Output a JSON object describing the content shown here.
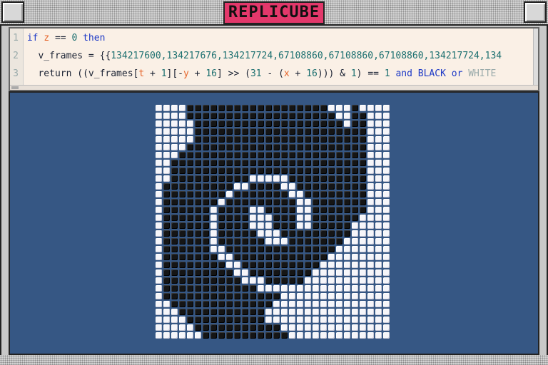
{
  "window": {
    "title": "REPLICUBE"
  },
  "editor": {
    "lines": [
      {
        "number": "1",
        "tokens": [
          {
            "t": "if ",
            "c": "kw"
          },
          {
            "t": "z",
            "c": "var"
          },
          {
            "t": " == ",
            "c": "code"
          },
          {
            "t": "0",
            "c": "num"
          },
          {
            "t": " then",
            "c": "kw"
          }
        ]
      },
      {
        "number": "2",
        "tokens": [
          {
            "t": "  v_frames = {{",
            "c": "code"
          },
          {
            "t": "134217600,134217676,134217724,67108860,67108860,67108860,134217724,134",
            "c": "num"
          }
        ]
      },
      {
        "number": "3",
        "tokens": [
          {
            "t": "  return ((v_frames[",
            "c": "code"
          },
          {
            "t": "t",
            "c": "var"
          },
          {
            "t": " + ",
            "c": "code"
          },
          {
            "t": "1",
            "c": "num"
          },
          {
            "t": "][-",
            "c": "code"
          },
          {
            "t": "y",
            "c": "var"
          },
          {
            "t": " + ",
            "c": "code"
          },
          {
            "t": "16",
            "c": "num"
          },
          {
            "t": "] >> (",
            "c": "code"
          },
          {
            "t": "31",
            "c": "num"
          },
          {
            "t": " - (",
            "c": "code"
          },
          {
            "t": "x",
            "c": "var"
          },
          {
            "t": " + ",
            "c": "code"
          },
          {
            "t": "16",
            "c": "num"
          },
          {
            "t": "))) & ",
            "c": "code"
          },
          {
            "t": "1",
            "c": "num"
          },
          {
            "t": ") == ",
            "c": "code"
          },
          {
            "t": "1",
            "c": "num"
          },
          {
            "t": " and ",
            "c": "kw"
          },
          {
            "t": "BLACK",
            "c": "blk"
          },
          {
            "t": " or ",
            "c": "kw"
          },
          {
            "t": "WHITE",
            "c": "wht"
          }
        ]
      }
    ]
  },
  "voxel_grid": {
    "columns": 30,
    "rows": 30,
    "colors": {
      "b": "#151515",
      "w": "#f6f6fa"
    },
    "pattern": [
      "wwwwbbbbbbbbbbbbbbbbbbwwwbwwww",
      "wwwwbbbbbbbbbbbbbbbbbbbwwbbwww",
      "wwwwwbbbbbbbbbbbbbbbbbbbwbbwww",
      "wwwwwbbbbbbbbbbbbbbbbbbbbbbwww",
      "wwwwwbbbbbbbbbbbbbbbbbbbbbbwww",
      "wwwwbbbbbbbbbbbbbbbbbbbbbbbwww",
      "wwwbbbbbbbbbbbbbbbbbbbbbbbbwww",
      "wwbbbbbbbbbbbbbbbbbbbbbbbbbwww",
      "wwbbbbbbbbbbbbbbbbbbbbbbbbbwww",
      "wwbbbbbbbbbbwwwwwbbbbbbbbbbwww",
      "wbbbbbbbbbwwbbbbwwbbbbbbbbbwww",
      "wbbbbbbbbwbbbbbbbwwbbbbbbbbwww",
      "wbbbbbbbwbbbbbbbbbwwbbbbbbbwww",
      "wbbbbbbwbbbbwwbbbbwwbbbbbbbwww",
      "wbbbbbbwbbbbwwwbbbwwbbbbbbwwww",
      "wbbbbbbwbbbbwwwbbbwwbbbbbwwwww",
      "wbbbbbbwbbbbbwwwbbbbbbbbbwwwww",
      "wbbbbbbwbbbbbbwwwbbbbbbbwwwwww",
      "wbbbbbbwwbbbbbbbbbbbbbbwwwwwww",
      "wbbbbbbbwwbbbbbbbbbbbbwwwwwwww",
      "wbbbbbbbbwwbbbbbbbbbbwwwwwwwww",
      "wbbbbbbbbbwwbbbbbbbbwwwwwwwwww",
      "wbbbbbbbbbbwwwbbbbbwwwwwwwwwww",
      "wbbbbbbbbbbbbwwwwwwwwwwwwwwwww",
      "wbbbbbbbbbbbbbbbwwwwwwwwwwwwww",
      "wwbbbbbbbbbbbbbwwwwwwwwwwwwwww",
      "wwwbbbbbbbbbbbwwwwwwwwwwwwwwww",
      "wwwwbbbbbbbbbbwwwwwwwwwwwwwwww",
      "wwwwwbbbbbbbbbbbwwwwwwwwwwwwww",
      "wwwwwwbbbbbbbbbbbwwwwwwwwwwwww"
    ]
  }
}
